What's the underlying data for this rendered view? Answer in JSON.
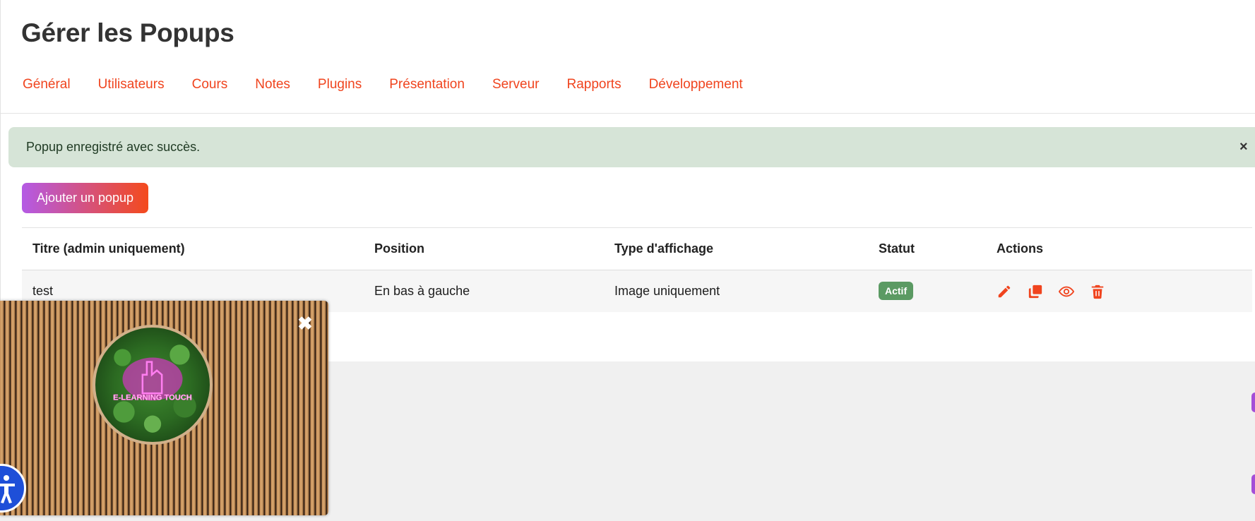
{
  "page": {
    "title": "Gérer les Popups"
  },
  "nav": [
    "Général",
    "Utilisateurs",
    "Cours",
    "Notes",
    "Plugins",
    "Présentation",
    "Serveur",
    "Rapports",
    "Développement"
  ],
  "alert": {
    "message": "Popup enregistré avec succès.",
    "close": "×"
  },
  "add_button": "Ajouter un popup",
  "table": {
    "headers": [
      "Titre (admin uniquement)",
      "Position",
      "Type d'affichage",
      "Statut",
      "Actions"
    ],
    "rows": [
      {
        "title": "test",
        "position": "En bas à gauche",
        "display_type": "Image uniquement",
        "status": "Actif"
      }
    ],
    "actions": [
      "pencil-icon",
      "duplicate-icon",
      "eye-icon",
      "trash-icon"
    ]
  },
  "popup": {
    "close": "✖",
    "logo_text": "E-LEARNING TOUCH"
  },
  "colors": {
    "accent": "#f0441e",
    "alert_bg": "#d6e4d7",
    "badge": "#5b9a63",
    "gradient_start": "#b45ae5",
    "gradient_end": "#f44a1c",
    "a11y": "#1e4fd8"
  }
}
